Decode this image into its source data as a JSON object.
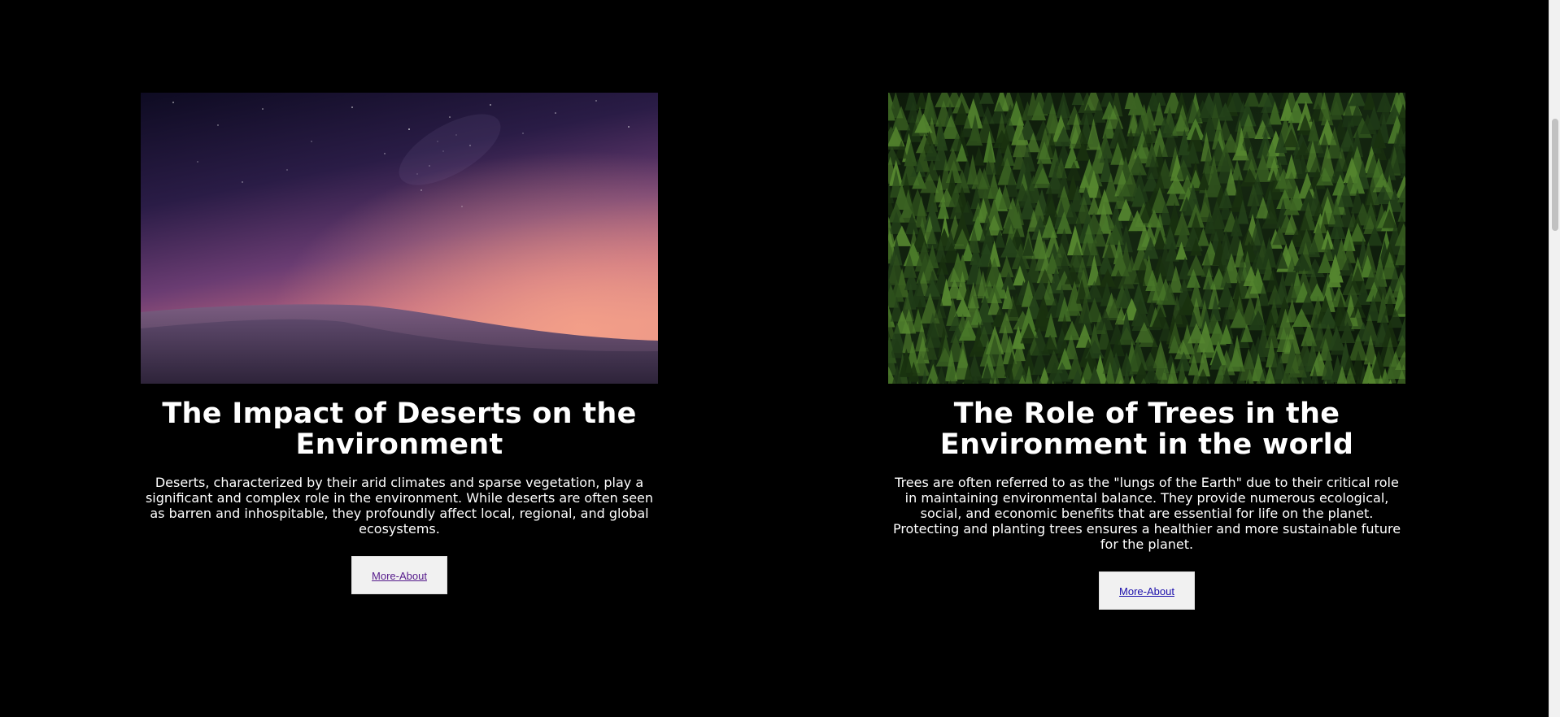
{
  "cards": [
    {
      "image": "desert-dunes-night-sky",
      "title": "The Impact of Deserts on the Environment",
      "text": "Deserts, characterized by their arid climates and sparse vegetation, play a significant and complex role in the environment. While deserts are often seen as barren and inhospitable, they profoundly affect local, regional, and global ecosystems.",
      "button": "More-About"
    },
    {
      "image": "pine-forest-aerial",
      "title": "The Role of Trees in the Environment in the world",
      "text": "Trees are often referred to as the \"lungs of the Earth\" due to their critical role in maintaining environmental balance. They provide numerous ecological, social, and economic benefits that are essential for life on the planet. Protecting and planting trees ensures a healthier and more sustainable future for the planet.",
      "button": "More-About"
    }
  ],
  "colors": {
    "background": "#000000",
    "text": "#ffffff",
    "button_bg": "#f1f1f1",
    "visited_link": "#551a8b",
    "link": "#1a0dab"
  }
}
